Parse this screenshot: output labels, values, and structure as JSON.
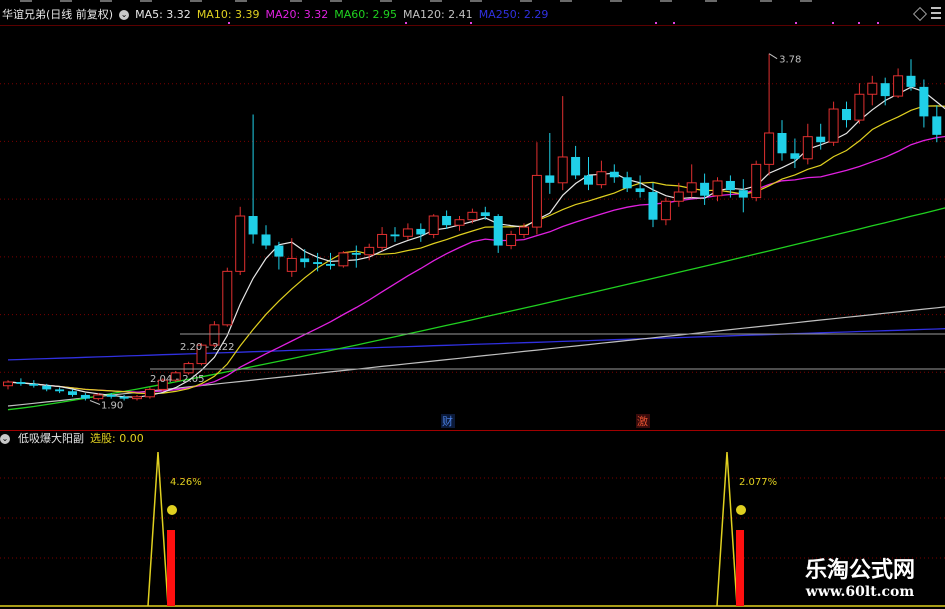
{
  "main_panel": {
    "title": "华谊兄弟(日线 前复权)",
    "indicators": [
      {
        "label": "MA5: 3.32",
        "color": "#e6e6e6"
      },
      {
        "label": "MA10: 3.39",
        "color": "#e0d020"
      },
      {
        "label": "MA20: 3.32",
        "color": "#e020e0"
      },
      {
        "label": "MA60: 2.95",
        "color": "#20d020"
      },
      {
        "label": "MA120: 2.41",
        "color": "#c0c0c0"
      },
      {
        "label": "MA250: 2.29",
        "color": "#3030e0"
      }
    ],
    "annotations": {
      "high": "3.78",
      "low": "1.90",
      "range_a": "2.20 - 2.22",
      "range_b": "2.04 - 2.05"
    },
    "event_markers": [
      {
        "label": "财",
        "color": "#4a7fe0"
      },
      {
        "label": "激",
        "color": "#e05030"
      }
    ]
  },
  "sub_panel": {
    "title": "低吸爆大阳副",
    "value_label": "选股: 0.00",
    "signals": [
      {
        "pct": "4.26%",
        "emoji": "☻"
      },
      {
        "pct": "2.077%",
        "emoji": "☻"
      }
    ]
  },
  "watermark": {
    "line1": "乐淘公式网",
    "line2": "www.60lt.com"
  },
  "colors": {
    "up": "#e03030",
    "down": "#20d0e8",
    "grid": "#7a0000",
    "separator": "#a00000"
  },
  "chart_data": {
    "type": "candlestick",
    "ylim": [
      1.74,
      3.93
    ],
    "candles": [
      [
        1.98,
        2.01,
        1.96,
        2.0
      ],
      [
        2.0,
        2.02,
        1.98,
        1.99
      ],
      [
        1.99,
        2.01,
        1.97,
        1.98
      ],
      [
        1.98,
        1.99,
        1.95,
        1.96
      ],
      [
        1.96,
        1.97,
        1.94,
        1.95
      ],
      [
        1.95,
        1.96,
        1.92,
        1.93
      ],
      [
        1.93,
        1.94,
        1.9,
        1.91
      ],
      [
        1.91,
        1.94,
        1.9,
        1.93
      ],
      [
        1.93,
        1.94,
        1.91,
        1.92
      ],
      [
        1.92,
        1.93,
        1.9,
        1.91
      ],
      [
        1.91,
        1.93,
        1.9,
        1.92
      ],
      [
        1.92,
        1.97,
        1.91,
        1.96
      ],
      [
        1.96,
        2.02,
        1.95,
        2.01
      ],
      [
        2.01,
        2.06,
        2.0,
        2.05
      ],
      [
        2.05,
        2.11,
        2.04,
        2.1
      ],
      [
        2.1,
        2.21,
        2.09,
        2.2
      ],
      [
        2.2,
        2.33,
        2.19,
        2.31
      ],
      [
        2.31,
        2.62,
        2.3,
        2.6
      ],
      [
        2.6,
        2.95,
        2.58,
        2.9
      ],
      [
        2.9,
        3.45,
        2.75,
        2.8
      ],
      [
        2.8,
        2.85,
        2.72,
        2.74
      ],
      [
        2.74,
        2.76,
        2.61,
        2.68
      ],
      [
        2.6,
        2.78,
        2.57,
        2.67
      ],
      [
        2.67,
        2.72,
        2.62,
        2.65
      ],
      [
        2.65,
        2.7,
        2.6,
        2.64
      ],
      [
        2.64,
        2.7,
        2.61,
        2.63
      ],
      [
        2.63,
        2.71,
        2.62,
        2.7
      ],
      [
        2.7,
        2.74,
        2.62,
        2.69
      ],
      [
        2.69,
        2.75,
        2.66,
        2.73
      ],
      [
        2.73,
        2.84,
        2.71,
        2.8
      ],
      [
        2.8,
        2.84,
        2.76,
        2.79
      ],
      [
        2.79,
        2.86,
        2.77,
        2.83
      ],
      [
        2.83,
        2.86,
        2.76,
        2.8
      ],
      [
        2.8,
        2.91,
        2.78,
        2.9
      ],
      [
        2.9,
        2.93,
        2.83,
        2.85
      ],
      [
        2.85,
        2.9,
        2.82,
        2.88
      ],
      [
        2.88,
        2.94,
        2.86,
        2.92
      ],
      [
        2.92,
        2.95,
        2.88,
        2.9
      ],
      [
        2.9,
        2.91,
        2.7,
        2.74
      ],
      [
        2.74,
        2.82,
        2.72,
        2.8
      ],
      [
        2.8,
        2.86,
        2.78,
        2.84
      ],
      [
        2.84,
        3.3,
        2.8,
        3.12
      ],
      [
        3.12,
        3.35,
        3.02,
        3.08
      ],
      [
        3.08,
        3.55,
        3.04,
        3.22
      ],
      [
        3.22,
        3.28,
        3.1,
        3.12
      ],
      [
        3.12,
        3.22,
        3.04,
        3.07
      ],
      [
        3.07,
        3.2,
        3.05,
        3.14
      ],
      [
        3.14,
        3.18,
        3.08,
        3.11
      ],
      [
        3.11,
        3.14,
        3.03,
        3.05
      ],
      [
        3.05,
        3.12,
        3.0,
        3.03
      ],
      [
        3.03,
        3.08,
        2.84,
        2.88
      ],
      [
        2.88,
        3.0,
        2.85,
        2.98
      ],
      [
        2.98,
        3.08,
        2.95,
        3.03
      ],
      [
        3.03,
        3.18,
        3.0,
        3.08
      ],
      [
        3.08,
        3.13,
        2.96,
        3.01
      ],
      [
        3.01,
        3.11,
        2.98,
        3.09
      ],
      [
        3.09,
        3.12,
        3.0,
        3.04
      ],
      [
        3.04,
        3.1,
        2.92,
        3.0
      ],
      [
        3.0,
        3.2,
        2.98,
        3.18
      ],
      [
        3.18,
        3.78,
        3.12,
        3.35
      ],
      [
        3.35,
        3.42,
        3.2,
        3.24
      ],
      [
        3.24,
        3.32,
        3.16,
        3.21
      ],
      [
        3.21,
        3.4,
        3.18,
        3.33
      ],
      [
        3.33,
        3.4,
        3.26,
        3.3
      ],
      [
        3.3,
        3.52,
        3.28,
        3.48
      ],
      [
        3.48,
        3.52,
        3.38,
        3.42
      ],
      [
        3.42,
        3.62,
        3.4,
        3.56
      ],
      [
        3.56,
        3.66,
        3.5,
        3.62
      ],
      [
        3.62,
        3.65,
        3.5,
        3.55
      ],
      [
        3.55,
        3.7,
        3.54,
        3.66
      ],
      [
        3.66,
        3.75,
        3.58,
        3.6
      ],
      [
        3.6,
        3.64,
        3.38,
        3.44
      ],
      [
        3.44,
        3.5,
        3.3,
        3.34
      ],
      [
        3.34,
        3.36,
        3.22,
        3.27
      ]
    ],
    "ma_latest": {
      "MA5": 3.32,
      "MA10": 3.39,
      "MA20": 3.32,
      "MA60": 2.95,
      "MA120": 2.41,
      "MA250": 2.29
    }
  }
}
